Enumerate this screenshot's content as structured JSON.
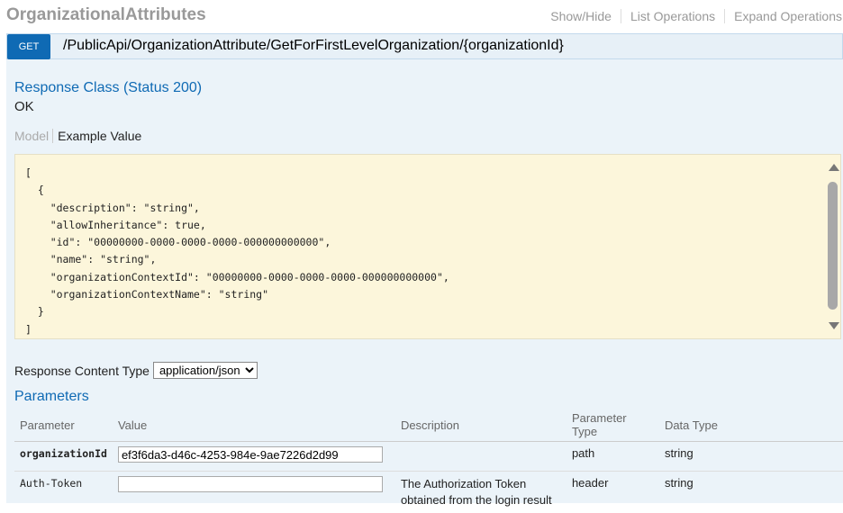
{
  "header": {
    "title": "OrganizationalAttributes",
    "links": [
      "Show/Hide",
      "List Operations",
      "Expand Operations"
    ]
  },
  "operation": {
    "method": "GET",
    "path": "/PublicApi/OrganizationAttribute/GetForFirstLevelOrganization/{organizationId}"
  },
  "response": {
    "heading": "Response Class (Status 200)",
    "status_text": "OK",
    "tabs": {
      "model": "Model",
      "example": "Example Value"
    },
    "example_json": "[\n  {\n    \"description\": \"string\",\n    \"allowInheritance\": true,\n    \"id\": \"00000000-0000-0000-0000-000000000000\",\n    \"name\": \"string\",\n    \"organizationContextId\": \"00000000-0000-0000-0000-000000000000\",\n    \"organizationContextName\": \"string\"\n  }\n]"
  },
  "content_type": {
    "label": "Response Content Type",
    "selected": "application/json"
  },
  "parameters": {
    "heading": "Parameters",
    "columns": [
      "Parameter",
      "Value",
      "Description",
      "Parameter Type",
      "Data Type"
    ],
    "rows": [
      {
        "name": "organizationId",
        "value": "ef3f6da3-d46c-4253-984e-9ae7226d2d99",
        "description": "",
        "param_type": "path",
        "data_type": "string"
      },
      {
        "name": "Auth-Token",
        "value": "",
        "description": "The Authorization Token obtained from the login result",
        "param_type": "header",
        "data_type": "string"
      }
    ]
  }
}
